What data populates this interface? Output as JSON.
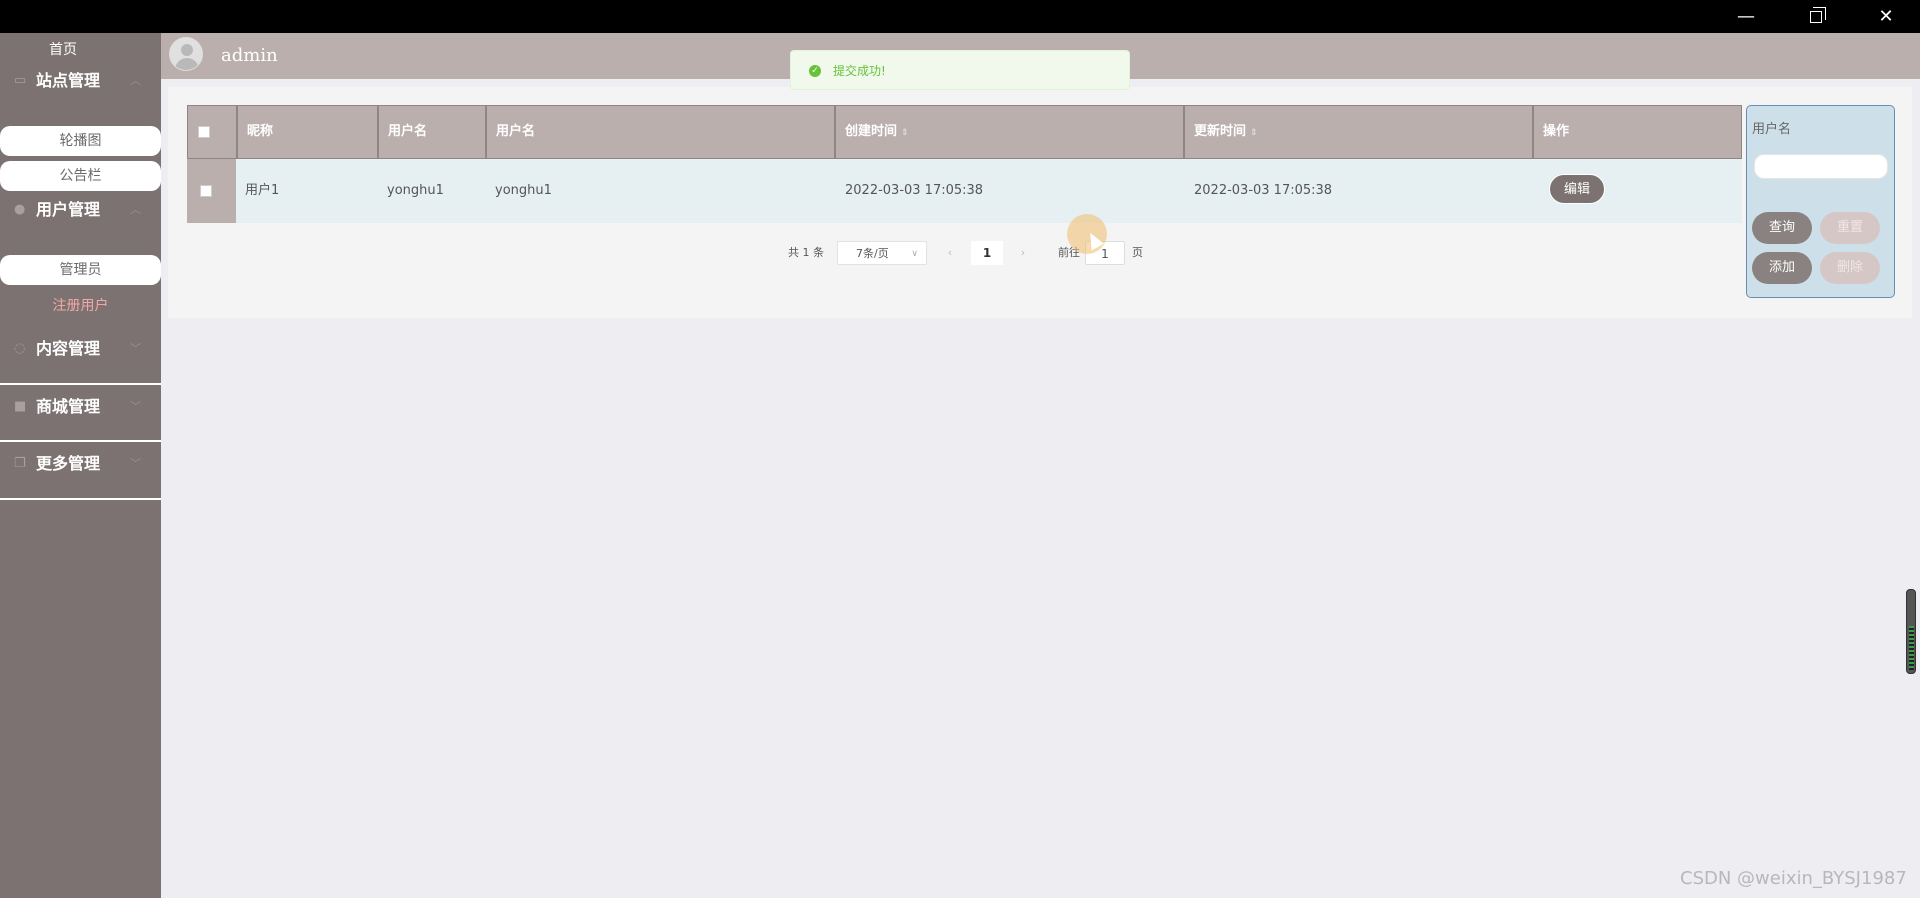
{
  "window": {
    "minimize_glyph": "—",
    "close_glyph": "✕"
  },
  "sidebar": {
    "home": "首页",
    "groups": [
      {
        "label": "站点管理",
        "icon": "monitor-icon",
        "items": [
          "轮播图",
          "公告栏"
        ]
      },
      {
        "label": "用户管理",
        "icon": "user-icon",
        "items": [
          "管理员",
          "注册用户"
        ]
      },
      {
        "label": "内容管理",
        "icon": "chat-icon",
        "items": []
      },
      {
        "label": "商城管理",
        "icon": "lock-icon",
        "items": []
      },
      {
        "label": "更多管理",
        "icon": "copy-icon",
        "items": []
      }
    ]
  },
  "header": {
    "username": "admin"
  },
  "toast": {
    "message": "提交成功!"
  },
  "table": {
    "columns": [
      "昵称",
      "用户名",
      "用户名",
      "创建时间",
      "更新时间",
      "操作"
    ],
    "rows": [
      {
        "nickname": "用户1",
        "username": "yonghu1",
        "username2": "yonghu1",
        "created": "2022-03-03 17:05:38",
        "updated": "2022-03-03 17:05:38",
        "action": "编辑"
      }
    ]
  },
  "pagination": {
    "total": "共 1 条",
    "page_size": "7条/页",
    "current_page": "1",
    "goto_prefix": "前往",
    "goto_value": "1",
    "goto_suffix": "页"
  },
  "search": {
    "label": "用户名",
    "buttons": [
      "查询",
      "重置",
      "添加",
      "删除"
    ]
  },
  "watermark": "CSDN @weixin_BYSJ1987",
  "colors": {
    "sidebar_bg": "#7b7271",
    "header_bg": "#bbafae",
    "row_bg": "#e6f0f2",
    "search_panel_bg": "#cde0ea",
    "toast_green": "#67c23a"
  }
}
